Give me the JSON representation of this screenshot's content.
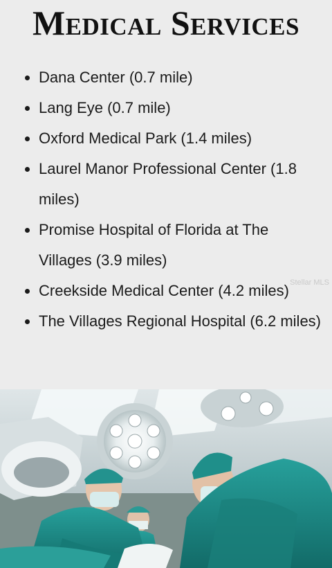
{
  "heading": "Medical Services",
  "services": [
    "Dana Center (0.7 mile)",
    "Lang Eye (0.7 mile)",
    "Oxford Medical Park (1.4 miles)",
    "Laurel Manor Professional Center (1.8 miles)",
    "Promise Hospital of Florida at The Villages (3.9 miles)",
    "Creekside Medical Center (4.2 miles)",
    "The Villages Regional Hospital (6.2 miles)"
  ],
  "watermark": "Stellar MLS",
  "photo": {
    "subject": "surgeons-in-operating-room-photo"
  },
  "colors": {
    "background": "#ececec",
    "text": "#111111",
    "scrubs": "#1e8a86"
  }
}
